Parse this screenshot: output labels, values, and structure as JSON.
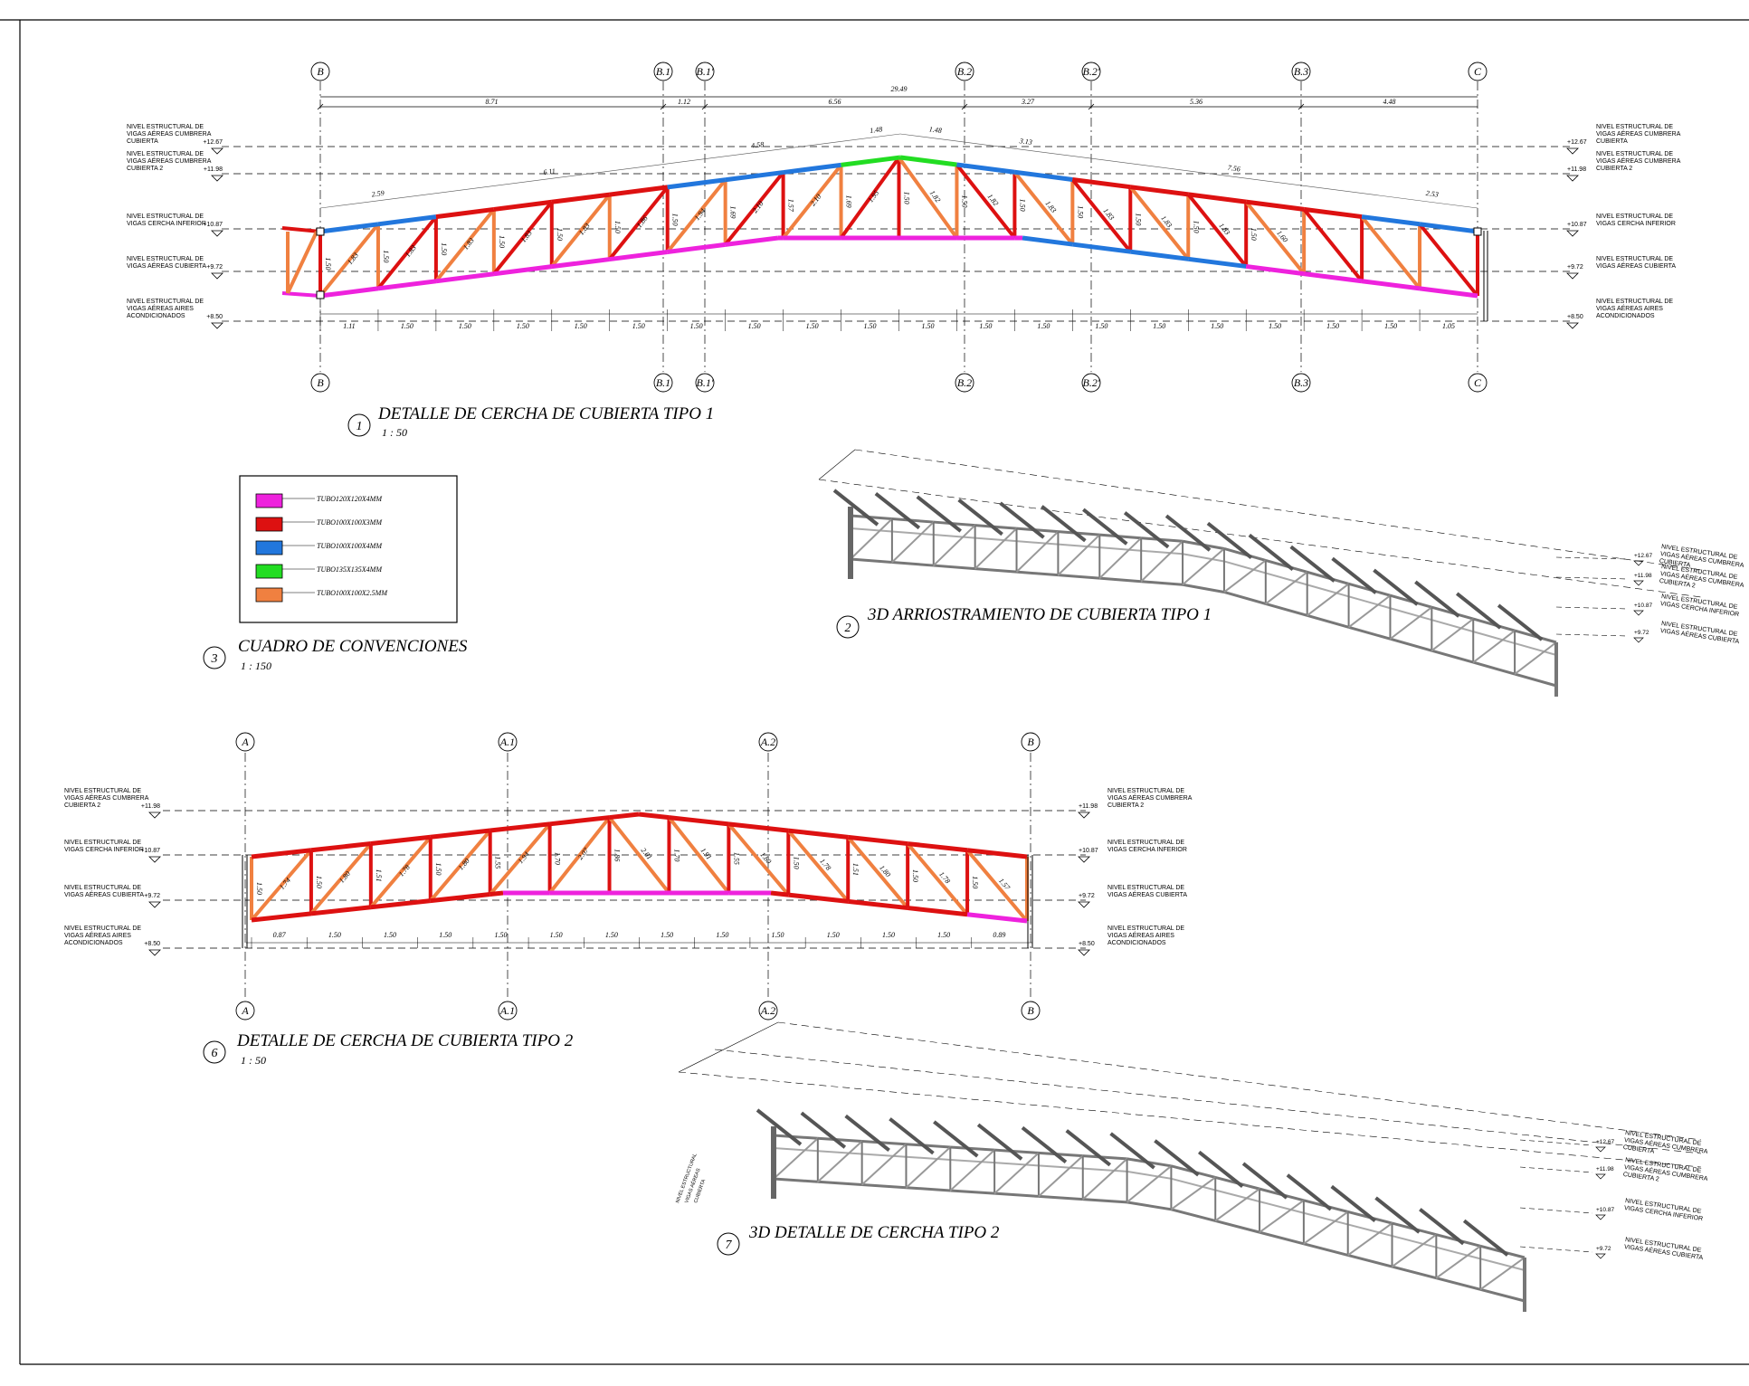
{
  "colors": {
    "magenta": "#ee22dd",
    "red": "#dd1111",
    "blue": "#2277dd",
    "green": "#22dd22",
    "orange": "#f08040",
    "line": "#000000",
    "steel": "#888888"
  },
  "views": {
    "v1": {
      "number": "1",
      "title": "DETALLE DE CERCHA DE CUBIERTA TIPO 1",
      "scale": "1 : 50"
    },
    "v2": {
      "number": "2",
      "title": "3D ARRIOSTRAMIENTO DE CUBIERTA TIPO 1"
    },
    "v3": {
      "number": "3",
      "title": "CUADRO DE CONVENCIONES",
      "scale": "1 : 150"
    },
    "v6": {
      "number": "6",
      "title": "DETALLE DE CERCHA DE CUBIERTA TIPO 2",
      "scale": "1 : 50"
    },
    "v7": {
      "number": "7",
      "title": "3D DETALLE DE CERCHA TIPO 2"
    }
  },
  "legend": [
    {
      "label": "TUBO120X120X4MM",
      "color": "#ee22dd"
    },
    {
      "label": "TUBO100X100X3MM",
      "color": "#dd1111"
    },
    {
      "label": "TUBO100X100X4MM",
      "color": "#2277dd"
    },
    {
      "label": "TUBO135X135X4MM",
      "color": "#22dd22"
    },
    {
      "label": "TUBO100X100X2.5MM",
      "color": "#f08040"
    }
  ],
  "truss1": {
    "grids": [
      "B",
      "B.1",
      "B.1'",
      "B.2",
      "B.2'",
      "B.3",
      "C"
    ],
    "total_dim": "29.49",
    "top_dims": [
      "8.71",
      "1.12",
      "6.56",
      "3.27",
      "5.36",
      "4.48"
    ],
    "slope_dims": [
      "2.59",
      "6.11",
      "4.58",
      "1.48",
      "1.48",
      "3.13",
      "7.56",
      "2.53"
    ],
    "bottom_dims": [
      "1.11",
      "1.50",
      "1.50",
      "1.50",
      "1.50",
      "1.50",
      "1.50",
      "1.50",
      "1.50",
      "1.50",
      "1.50",
      "1.50",
      "1.50",
      "1.50",
      "1.50",
      "1.50",
      "1.50",
      "1.50",
      "1.50",
      "1.05"
    ],
    "member_labels": [
      "1.50",
      "1.83",
      "1.50",
      "1.83",
      "1.50",
      "1.83",
      "1.50",
      "1.83",
      "1.50",
      "1.83",
      "1.50",
      "1.86",
      "1.50",
      "1.94",
      "1.69",
      "2.10",
      "1.57",
      "2.10",
      "1.69",
      "1.95",
      "1.50",
      "1.82",
      "1.50",
      "1.82",
      "1.50",
      "1.83",
      "1.50",
      "1.83",
      "1.50",
      "1.83",
      "1.50",
      "1.83",
      "1.50",
      "1.60"
    ],
    "levels": [
      {
        "name": "NIVEL ESTRUCTURAL DE VIGAS AÉREAS CUMBRERA CUBIERTA",
        "elev": "+12.67"
      },
      {
        "name": "NIVEL ESTRUCTURAL DE VIGAS AÉREAS CUMBRERA CUBIERTA 2",
        "elev": "+11.98"
      },
      {
        "name": "NIVEL ESTRUCTURAL DE VIGAS CERCHA INFERIOR",
        "elev": "+10.87"
      },
      {
        "name": "NIVEL ESTRUCTURAL DE VIGAS AÉREAS CUBIERTA",
        "elev": "+9.72"
      },
      {
        "name": "NIVEL ESTRUCTURAL DE VIGAS AÉREAS AIRES ACONDICIONADOS",
        "elev": "+8.50"
      }
    ]
  },
  "truss2": {
    "grids": [
      "A",
      "A.1",
      "A.2",
      "B"
    ],
    "bottom_dims": [
      "0.87",
      "1.50",
      "1.50",
      "1.50",
      "1.50",
      "1.50",
      "1.50",
      "1.50",
      "1.50",
      "1.50",
      "1.50",
      "1.50",
      "1.50",
      "0.89"
    ],
    "member_labels": [
      "1.50",
      "1.74",
      "1.50",
      "1.80",
      "1.51",
      "1.78",
      "1.50",
      "1.80",
      "1.55",
      "1.94",
      "1.70",
      "2.07",
      "1.86",
      "2.01",
      "1.70",
      "1.91",
      "1.55",
      "1.80",
      "1.50",
      "1.78",
      "1.51",
      "1.80",
      "1.50",
      "1.78",
      "1.50",
      "1.57"
    ],
    "levels": [
      {
        "name": "NIVEL ESTRUCTURAL DE VIGAS AÉREAS CUMBRERA CUBIERTA 2",
        "elev": "+11.98"
      },
      {
        "name": "NIVEL ESTRUCTURAL DE VIGAS CERCHA INFERIOR",
        "elev": "+10.87"
      },
      {
        "name": "NIVEL ESTRUCTURAL DE VIGAS AÉREAS CUBIERTA",
        "elev": "+9.72"
      },
      {
        "name": "NIVEL ESTRUCTURAL DE VIGAS AÉREAS AIRES ACONDICIONADOS",
        "elev": "+8.50"
      }
    ]
  },
  "view2_levels": [
    {
      "name": "NIVEL ESTRUCTURAL DE VIGAS AÉREAS CUMBRERA CUBIERTA",
      "elev": "+12.67"
    },
    {
      "name": "NIVEL ESTRUCTURAL DE VIGAS AÉREAS CUMBRERA CUBIERTA 2",
      "elev": "+11.98"
    },
    {
      "name": "NIVEL ESTRUCTURAL DE VIGAS CERCHA INFERIOR",
      "elev": "+10.87"
    },
    {
      "name": "NIVEL ESTRUCTURAL DE VIGAS AÉREAS CUBIERTA",
      "elev": "+9.72"
    }
  ],
  "view7_levels": [
    {
      "name": "NIVEL ESTRUCTURAL DE VIGAS AÉREAS CUMBRERA CUBIERTA",
      "elev": "+12.67"
    },
    {
      "name": "NIVEL ESTRUCTURAL DE VIGAS AÉREAS CUMBRERA CUBIERTA 2",
      "elev": "+11.98"
    },
    {
      "name": "NIVEL ESTRUCTURAL DE VIGAS CERCHA INFERIOR",
      "elev": "+10.87"
    },
    {
      "name": "NIVEL ESTRUCTURAL DE VIGAS AÉREAS CUBIERTA",
      "elev": "+9.72"
    }
  ]
}
